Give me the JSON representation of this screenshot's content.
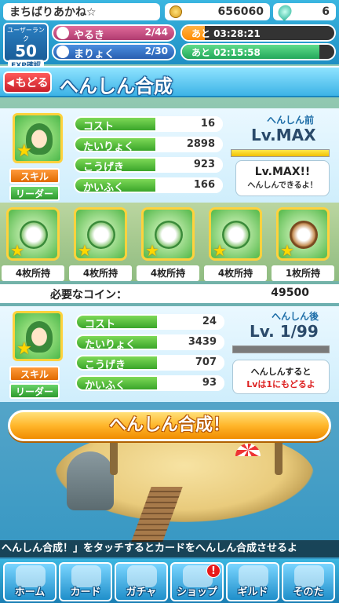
{
  "header": {
    "player_name": "まちばりあかね☆",
    "coins": "656060",
    "gems": "6",
    "rank_label": "ユーザーランク",
    "rank": "50",
    "exp_label": "EXP確認",
    "stamina": {
      "label": "やるき",
      "value": "2/44",
      "timer": "あと 03:28:21",
      "fill": 0.15
    },
    "mana": {
      "label": "まりょく",
      "value": "2/30",
      "timer": "あと 02:15:58",
      "fill": 0.9
    }
  },
  "titlebar": {
    "back_label": "もどる",
    "title": "へんしん合成"
  },
  "before": {
    "side_label": "へんしん前",
    "level": "Lv.MAX",
    "note_line1": "Lv.MAX!!",
    "note_line2": "へんしんできるよ！",
    "skill_label": "スキル",
    "leader_label": "リーダー",
    "stats": [
      {
        "label": "コスト",
        "value": "16"
      },
      {
        "label": "たいりょく",
        "value": "2898"
      },
      {
        "label": "こうげき",
        "value": "923"
      },
      {
        "label": "かいふく",
        "value": "166"
      }
    ]
  },
  "materials": [
    {
      "count": "4枚所持",
      "icon": "tea-cup-card-icon"
    },
    {
      "count": "4枚所持",
      "icon": "tea-cup-card-icon"
    },
    {
      "count": "4枚所持",
      "icon": "tea-cup-card-icon"
    },
    {
      "count": "4枚所持",
      "icon": "tea-cup-card-icon"
    },
    {
      "count": "1枚所持",
      "icon": "brown-card-icon"
    }
  ],
  "coin_cost": {
    "label": "必要なコイン：",
    "value": "49500"
  },
  "after": {
    "side_label": "へんしん後",
    "level": "Lv. 1/99",
    "note_line1": "へんしんすると",
    "note_line2": "Lvは1にもどるよ",
    "skill_label": "スキル",
    "leader_label": "リーダー",
    "stats": [
      {
        "label": "コスト",
        "value": "24"
      },
      {
        "label": "たいりょく",
        "value": "3439"
      },
      {
        "label": "こうげき",
        "value": "707"
      },
      {
        "label": "かいふく",
        "value": "93"
      }
    ]
  },
  "action_button": "へんしん合成！",
  "ticker": "へんしん合成！」をタッチするとカードをへんしん合成させるよ",
  "nav": [
    {
      "label": "ホーム",
      "icon": "home-icon"
    },
    {
      "label": "カード",
      "icon": "card-icon"
    },
    {
      "label": "ガチャ",
      "icon": "gacha-icon"
    },
    {
      "label": "ショップ",
      "icon": "shop-icon",
      "badge": "!"
    },
    {
      "label": "ギルド",
      "icon": "guild-icon"
    },
    {
      "label": "そのた",
      "icon": "other-icon"
    }
  ],
  "colors": {
    "accent": "#3bb6e0",
    "button_orange": "#ffb62b",
    "stat_green": "#3aa52a"
  }
}
